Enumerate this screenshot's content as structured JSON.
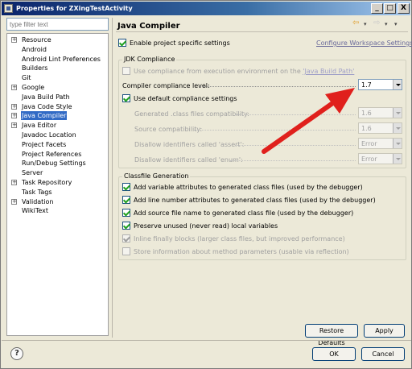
{
  "window": {
    "title": "Properties for ZXingTestActivity",
    "controls": [
      "_",
      "□",
      "X"
    ]
  },
  "filter": {
    "placeholder": "type filter text"
  },
  "tree": [
    {
      "label": "Resource",
      "expandable": true,
      "selected": false
    },
    {
      "label": "Android",
      "expandable": false,
      "selected": false
    },
    {
      "label": "Android Lint Preferences",
      "expandable": false,
      "selected": false
    },
    {
      "label": "Builders",
      "expandable": false,
      "selected": false
    },
    {
      "label": "Git",
      "expandable": false,
      "selected": false
    },
    {
      "label": "Google",
      "expandable": true,
      "selected": false
    },
    {
      "label": "Java Build Path",
      "expandable": false,
      "selected": false
    },
    {
      "label": "Java Code Style",
      "expandable": true,
      "selected": false
    },
    {
      "label": "Java Compiler",
      "expandable": true,
      "selected": true
    },
    {
      "label": "Java Editor",
      "expandable": true,
      "selected": false
    },
    {
      "label": "Javadoc Location",
      "expandable": false,
      "selected": false
    },
    {
      "label": "Project Facets",
      "expandable": false,
      "selected": false
    },
    {
      "label": "Project References",
      "expandable": false,
      "selected": false
    },
    {
      "label": "Run/Debug Settings",
      "expandable": false,
      "selected": false
    },
    {
      "label": "Server",
      "expandable": false,
      "selected": false
    },
    {
      "label": "Task Repository",
      "expandable": true,
      "selected": false
    },
    {
      "label": "Task Tags",
      "expandable": false,
      "selected": false
    },
    {
      "label": "Validation",
      "expandable": true,
      "selected": false
    },
    {
      "label": "WikiText",
      "expandable": false,
      "selected": false
    }
  ],
  "page": {
    "title": "Java Compiler",
    "enable_specific": "Enable project specific settings",
    "configure_link": "Configure Workspace Settings..."
  },
  "jdk": {
    "group_title": "JDK Compliance",
    "use_env_prefix": "Use compliance from execution environment on the ",
    "use_env_link": "'Java Build Path'",
    "compliance_label": "Compiler compliance level:",
    "compliance_value": "1.7",
    "use_default": "Use default compliance settings",
    "generated_label": "Generated .class files compatibility:",
    "generated_value": "1.6",
    "source_label": "Source compatibility:",
    "source_value": "1.6",
    "assert_label": "Disallow identifiers called 'assert':",
    "assert_value": "Error",
    "enum_label": "Disallow identifiers called 'enum':",
    "enum_value": "Error"
  },
  "classfile": {
    "group_title": "Classfile Generation",
    "opt1": "Add variable attributes to generated class files (used by the debugger)",
    "opt2": "Add line number attributes to generated class files (used by the debugger)",
    "opt3": "Add source file name to generated class file (used by the debugger)",
    "opt4": "Preserve unused (never read) local variables",
    "opt5": "Inline finally blocks (larger class files, but improved performance)",
    "opt6": "Store information about method parameters (usable via reflection)"
  },
  "buttons": {
    "restore": "Restore Defaults",
    "apply": "Apply",
    "ok": "OK",
    "cancel": "Cancel",
    "help": "?"
  },
  "colors": {
    "selection": "#316ac5",
    "annotation_arrow": "#e0201c",
    "check": "#21a121"
  }
}
